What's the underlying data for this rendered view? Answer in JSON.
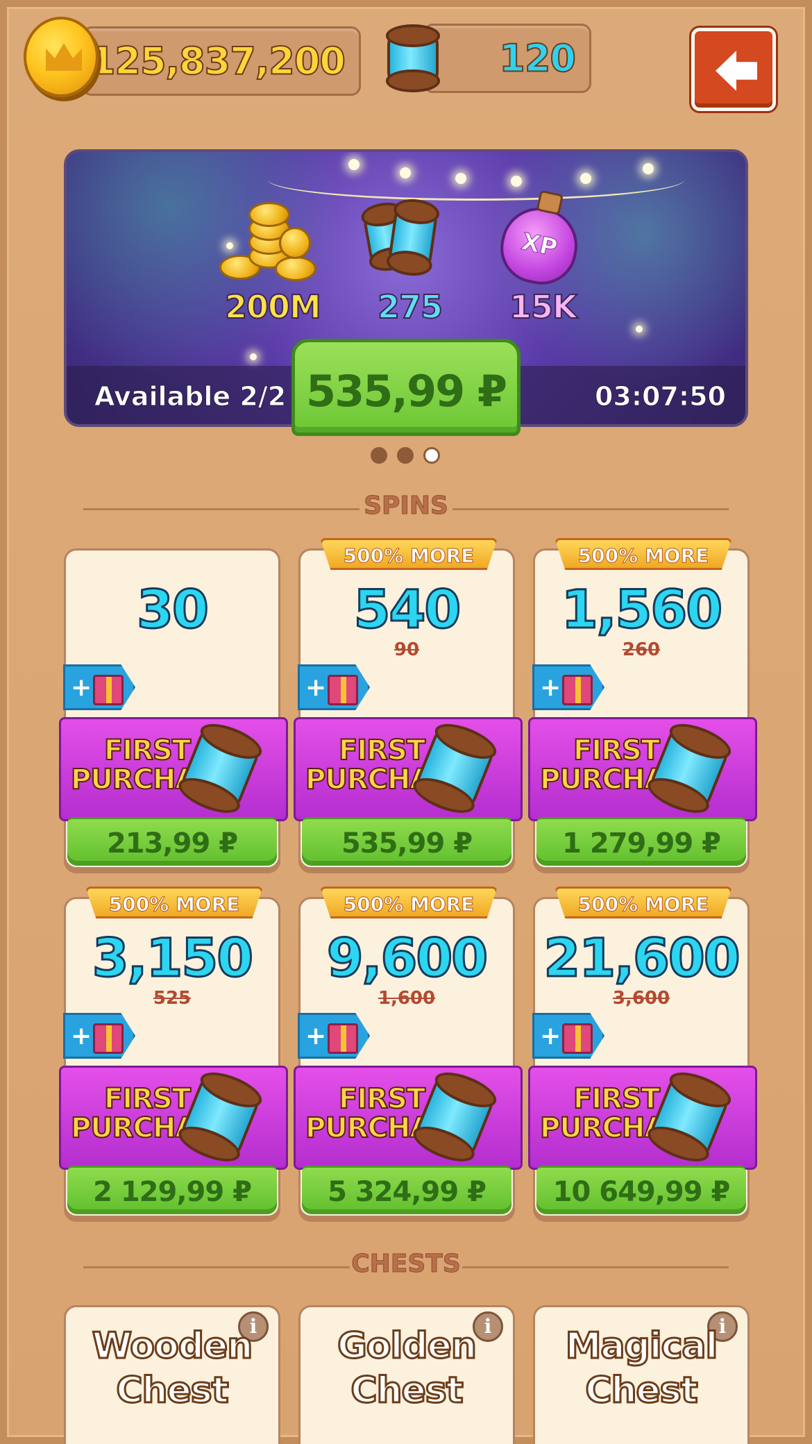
{
  "top_bar": {
    "coins": "125,837,200",
    "spins": "120"
  },
  "banner": {
    "rewards": [
      {
        "value": "200M",
        "icon": "coin-stack-icon",
        "color": "#ffe04a"
      },
      {
        "value": "275",
        "icon": "spin-capsules-icon",
        "color": "#62dcf5"
      },
      {
        "value": "15K",
        "icon": "xp-potion-icon",
        "color": "#f5b4f5"
      }
    ],
    "xp_label": "XP",
    "available": "Available 2/2",
    "price": "535,99 ₽",
    "timer": "03:07:50",
    "pager": {
      "count": 3,
      "active": 2
    }
  },
  "sections": {
    "spins_title": "SPINS",
    "chests_title": "CHESTS"
  },
  "spin_offers": [
    {
      "amount": "30",
      "badge": "",
      "old_amount": "",
      "label_line1": "FIRST",
      "label_line2": "PURCHASE",
      "price": "213,99 ₽"
    },
    {
      "amount": "540",
      "badge": "500% MORE",
      "old_amount": "90",
      "label_line1": "FIRST",
      "label_line2": "PURCHASE",
      "price": "535,99 ₽"
    },
    {
      "amount": "1,560",
      "badge": "500% MORE",
      "old_amount": "260",
      "label_line1": "FIRST",
      "label_line2": "PURCHASE",
      "price": "1 279,99 ₽"
    },
    {
      "amount": "3,150",
      "badge": "500% MORE",
      "old_amount": "525",
      "label_line1": "FIRST",
      "label_line2": "PURCHASE",
      "price": "2 129,99 ₽"
    },
    {
      "amount": "9,600",
      "badge": "500% MORE",
      "old_amount": "1,600",
      "label_line1": "FIRST",
      "label_line2": "PURCHASE",
      "price": "5 324,99 ₽"
    },
    {
      "amount": "21,600",
      "badge": "500% MORE",
      "old_amount": "3,600",
      "label_line1": "FIRST",
      "label_line2": "PURCHASE",
      "price": "10 649,99 ₽"
    }
  ],
  "gift_tag": {
    "plus": "+"
  },
  "chests": [
    {
      "line1": "Wooden",
      "line2": "Chest"
    },
    {
      "line1": "Golden",
      "line2": "Chest"
    },
    {
      "line1": "Magical",
      "line2": "Chest"
    }
  ],
  "info_glyph": "i"
}
